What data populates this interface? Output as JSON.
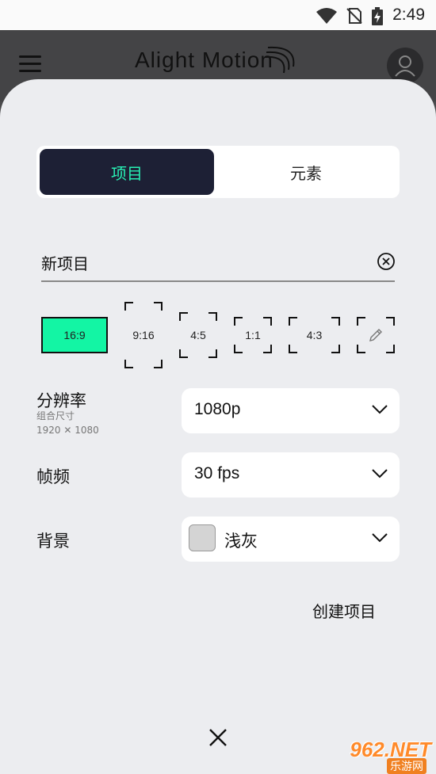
{
  "status": {
    "time": "2:49"
  },
  "header": {
    "logo_text": "Alight Motion"
  },
  "tabs": [
    {
      "label": "项目",
      "active": true
    },
    {
      "label": "元素",
      "active": false
    }
  ],
  "project_name": {
    "value": "新项目"
  },
  "aspect_ratios": [
    {
      "label": "16:9",
      "selected": true
    },
    {
      "label": "9:16",
      "selected": false
    },
    {
      "label": "4:5",
      "selected": false
    },
    {
      "label": "1:1",
      "selected": false
    },
    {
      "label": "4:3",
      "selected": false
    }
  ],
  "resolution": {
    "label": "分辨率",
    "sub_label": "组合尺寸",
    "dimensions": "1920 ✕ 1080",
    "value": "1080p"
  },
  "frame_rate": {
    "label": "帧频",
    "value": "30 fps"
  },
  "background": {
    "label": "背景",
    "value": "浅灰",
    "swatch_color": "#d4d4d4"
  },
  "actions": {
    "create_label": "创建项目"
  },
  "watermark": {
    "text": "962.NET",
    "sub": "乐游网"
  },
  "colors": {
    "accent": "#13f5a4",
    "tab_active_bg": "#1d2035",
    "tab_active_text": "#28f0b4"
  }
}
